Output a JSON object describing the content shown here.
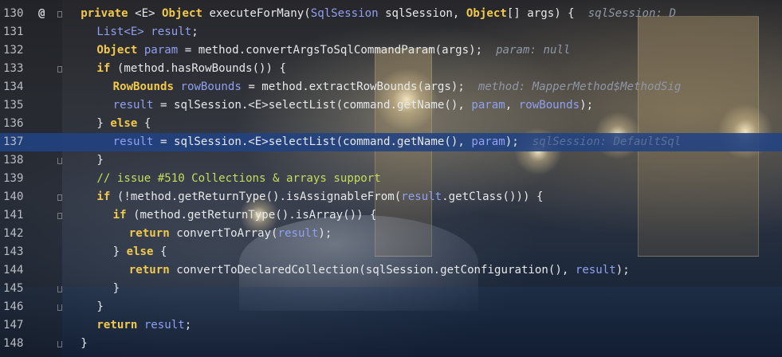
{
  "editor": {
    "background_theme": "London Tower Bridge night photo",
    "highlighted_line": 137,
    "lines": [
      {
        "num": "130",
        "marker": "@",
        "fold": "start",
        "indent": 1,
        "tokens": [
          [
            "kw",
            "private"
          ],
          [
            "pl",
            " <E> "
          ],
          [
            "tp",
            "Object"
          ],
          [
            "pl",
            " executeForMany("
          ],
          [
            "vr",
            "SqlSession"
          ],
          [
            "pl",
            " sqlSession, "
          ],
          [
            "tp",
            "Object"
          ],
          [
            "pl",
            "[] args) {  "
          ],
          [
            "hint",
            "sqlSession: D"
          ]
        ]
      },
      {
        "num": "131",
        "marker": "",
        "fold": "",
        "indent": 2,
        "tokens": [
          [
            "vr",
            "List<E>"
          ],
          [
            "pl",
            " "
          ],
          [
            "vr",
            "result"
          ],
          [
            "pl",
            ";"
          ]
        ]
      },
      {
        "num": "132",
        "marker": "",
        "fold": "",
        "indent": 2,
        "tokens": [
          [
            "tp",
            "Object"
          ],
          [
            "pl",
            " "
          ],
          [
            "vr",
            "param"
          ],
          [
            "pl",
            " = method.convertArgsToSqlCommandParam(args);  "
          ],
          [
            "hint",
            "param: null"
          ]
        ]
      },
      {
        "num": "133",
        "marker": "",
        "fold": "start",
        "indent": 2,
        "tokens": [
          [
            "kw",
            "if"
          ],
          [
            "pl",
            " (method.hasRowBounds()) {"
          ]
        ]
      },
      {
        "num": "134",
        "marker": "",
        "fold": "",
        "indent": 3,
        "tokens": [
          [
            "tp",
            "RowBounds"
          ],
          [
            "pl",
            " "
          ],
          [
            "vr",
            "rowBounds"
          ],
          [
            "pl",
            " = method.extractRowBounds(args);  "
          ],
          [
            "hint",
            "method: MapperMethod$MethodSig"
          ]
        ]
      },
      {
        "num": "135",
        "marker": "",
        "fold": "",
        "indent": 3,
        "tokens": [
          [
            "vr",
            "result"
          ],
          [
            "pl",
            " = sqlSession.<E>selectList(command.getName(), "
          ],
          [
            "vr",
            "param"
          ],
          [
            "pl",
            ", "
          ],
          [
            "vr",
            "rowBounds"
          ],
          [
            "pl",
            ");"
          ]
        ]
      },
      {
        "num": "136",
        "marker": "",
        "fold": "mid",
        "indent": 2,
        "tokens": [
          [
            "pl",
            "} "
          ],
          [
            "kw",
            "else"
          ],
          [
            "pl",
            " {"
          ]
        ]
      },
      {
        "num": "137",
        "marker": "",
        "fold": "",
        "indent": 3,
        "tokens": [
          [
            "vr",
            "result"
          ],
          [
            "pl",
            " = sqlSession.<E>selectList(command.getName(), "
          ],
          [
            "vr",
            "param"
          ],
          [
            "pl",
            ");  "
          ],
          [
            "hint-faded",
            "sqlSession: DefaultSql"
          ]
        ]
      },
      {
        "num": "138",
        "marker": "",
        "fold": "end",
        "indent": 2,
        "tokens": [
          [
            "pl",
            "}"
          ]
        ]
      },
      {
        "num": "139",
        "marker": "",
        "fold": "",
        "indent": 2,
        "tokens": [
          [
            "cm",
            "// issue #510 Collections & arrays support"
          ]
        ]
      },
      {
        "num": "140",
        "marker": "",
        "fold": "start",
        "indent": 2,
        "tokens": [
          [
            "kw",
            "if"
          ],
          [
            "pl",
            " (!method.getReturnType().isAssignableFrom("
          ],
          [
            "vr",
            "result"
          ],
          [
            "pl",
            ".getClass())) {"
          ]
        ]
      },
      {
        "num": "141",
        "marker": "",
        "fold": "start",
        "indent": 3,
        "tokens": [
          [
            "kw",
            "if"
          ],
          [
            "pl",
            " (method.getReturnType().isArray()) {"
          ]
        ]
      },
      {
        "num": "142",
        "marker": "",
        "fold": "",
        "indent": 4,
        "tokens": [
          [
            "kw",
            "return"
          ],
          [
            "pl",
            " convertToArray("
          ],
          [
            "vr",
            "result"
          ],
          [
            "pl",
            ");"
          ]
        ]
      },
      {
        "num": "143",
        "marker": "",
        "fold": "mid",
        "indent": 3,
        "tokens": [
          [
            "pl",
            "} "
          ],
          [
            "kw",
            "else"
          ],
          [
            "pl",
            " {"
          ]
        ]
      },
      {
        "num": "144",
        "marker": "",
        "fold": "",
        "indent": 4,
        "tokens": [
          [
            "kw",
            "return"
          ],
          [
            "pl",
            " convertToDeclaredCollection(sqlSession.getConfiguration(), "
          ],
          [
            "vr",
            "result"
          ],
          [
            "pl",
            ");"
          ]
        ]
      },
      {
        "num": "145",
        "marker": "",
        "fold": "end",
        "indent": 3,
        "tokens": [
          [
            "pl",
            "}"
          ]
        ]
      },
      {
        "num": "146",
        "marker": "",
        "fold": "end",
        "indent": 2,
        "tokens": [
          [
            "pl",
            "}"
          ]
        ]
      },
      {
        "num": "147",
        "marker": "",
        "fold": "",
        "indent": 2,
        "tokens": [
          [
            "kw",
            "return"
          ],
          [
            "pl",
            " "
          ],
          [
            "vr",
            "result"
          ],
          [
            "pl",
            ";"
          ]
        ]
      },
      {
        "num": "148",
        "marker": "",
        "fold": "end",
        "indent": 1,
        "tokens": [
          [
            "pl",
            "}"
          ]
        ]
      }
    ]
  },
  "colors": {
    "keyword": "#f2c94c",
    "variable": "#8fa0f0",
    "comment": "#c6dd5a",
    "inline_hint": "#8f97a6",
    "caret_row": "#214283"
  }
}
